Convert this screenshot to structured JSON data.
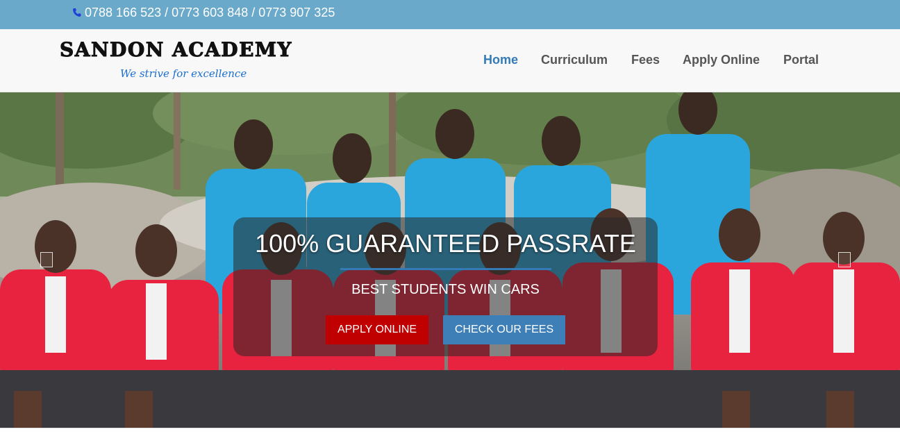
{
  "topbar": {
    "phone_icon": "phone-icon",
    "phones": "0788 166 523 / 0773 603 848 / 0773 907 325"
  },
  "brand": {
    "title": "SANDON ACADEMY",
    "tagline": "We strive for excellence"
  },
  "nav": {
    "items": [
      {
        "label": "Home",
        "active": true
      },
      {
        "label": "Curriculum",
        "active": false
      },
      {
        "label": "Fees",
        "active": false
      },
      {
        "label": "Apply Online",
        "active": false
      },
      {
        "label": "Portal",
        "active": false
      }
    ]
  },
  "hero": {
    "headline": "100% GUARANTEED PASSRATE",
    "subhead": "BEST STUDENTS WIN CARS",
    "apply_button": "APPLY ONLINE",
    "fees_button": "CHECK OUR FEES",
    "prev_icon": "chevron-left-icon",
    "next_icon": "chevron-right-icon"
  },
  "colors": {
    "topbar": "#6aa9c9",
    "nav_active": "#337ab7",
    "apply_button": "#c00000",
    "fees_button": "#3f7fb8",
    "tagline": "#1a6fd0"
  }
}
